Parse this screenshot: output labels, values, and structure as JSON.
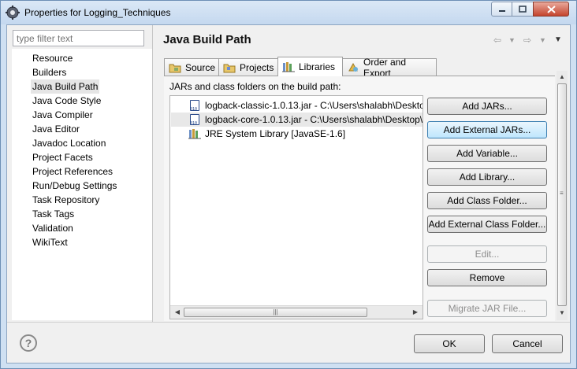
{
  "window": {
    "title": "Properties for Logging_Techniques"
  },
  "filter": {
    "placeholder": "type filter text"
  },
  "nav": {
    "items": [
      "Resource",
      "Builders",
      "Java Build Path",
      "Java Code Style",
      "Java Compiler",
      "Java Editor",
      "Javadoc Location",
      "Project Facets",
      "Project References",
      "Run/Debug Settings",
      "Task Repository",
      "Task Tags",
      "Validation",
      "WikiText"
    ],
    "selected": "Java Build Path"
  },
  "page": {
    "title": "Java Build Path"
  },
  "tabs": [
    {
      "label": "Source",
      "icon": "source-folder-icon"
    },
    {
      "label": "Projects",
      "icon": "projects-icon"
    },
    {
      "label": "Libraries",
      "icon": "libraries-icon",
      "active": true
    },
    {
      "label": "Order and Export",
      "icon": "order-export-icon"
    }
  ],
  "libraries": {
    "section_label": "JARs and class folders on the build path:",
    "entries": [
      "logback-classic-1.0.13.jar - C:\\Users\\shalabh\\Deskto",
      "logback-core-1.0.13.jar - C:\\Users\\shalabh\\Desktop\\",
      "JRE System Library [JavaSE-1.6]"
    ],
    "buttons": [
      {
        "label": "Add JARs...",
        "enabled": true
      },
      {
        "label": "Add External JARs...",
        "enabled": true,
        "focused": true
      },
      {
        "label": "Add Variable...",
        "enabled": true
      },
      {
        "label": "Add Library...",
        "enabled": true
      },
      {
        "label": "Add Class Folder...",
        "enabled": true
      },
      {
        "label": "Add External Class Folder...",
        "enabled": true
      },
      {
        "label": "Edit...",
        "enabled": false
      },
      {
        "label": "Remove",
        "enabled": true
      },
      {
        "label": "Migrate JAR File...",
        "enabled": false
      }
    ]
  },
  "dialog": {
    "ok_label": "OK",
    "cancel_label": "Cancel"
  },
  "colors": {
    "accent": "#3c7fb1",
    "selection": "#e5e5e5"
  }
}
